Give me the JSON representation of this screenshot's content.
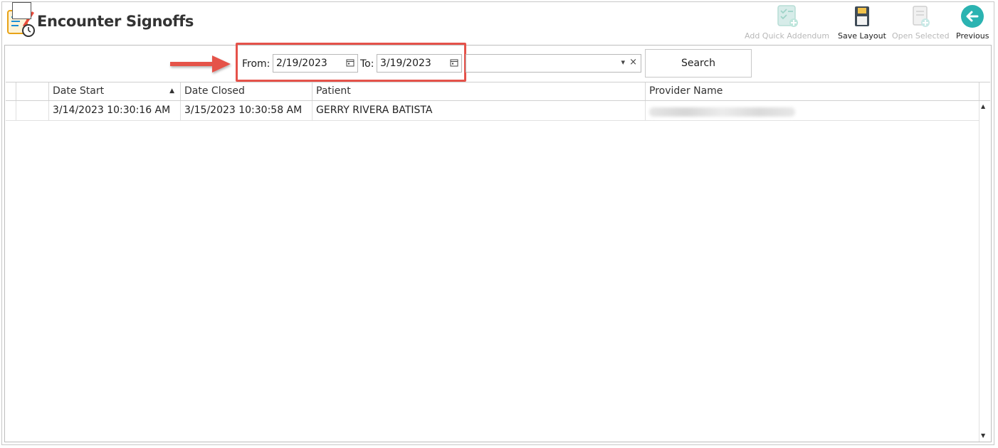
{
  "header": {
    "title": "Encounter Signoffs",
    "icons": {
      "logo": "clipboard-pencil-clock-icon"
    }
  },
  "toolbar": {
    "add_quick_addendum": "Add Quick Addendum",
    "save_layout": "Save Layout",
    "open_selected": "Open Selected",
    "previous": "Previous"
  },
  "filters": {
    "from_label": "From:",
    "from_value": "2/19/2023",
    "to_label": "To:",
    "to_value": "3/19/2023",
    "search_label": "Search",
    "clear_symbol": "×",
    "dropdown_symbol": "▾"
  },
  "grid": {
    "columns": [
      "Date Start",
      "Date Closed",
      "Patient",
      "Provider Name"
    ],
    "sort_symbol": "▲",
    "rows": [
      {
        "date_start": "3/14/2023 10:30:16 AM",
        "date_closed": "3/15/2023 10:30:58 AM",
        "patient": "GERRY RIVERA BATISTA",
        "provider": ""
      }
    ]
  },
  "colors": {
    "highlight": "#e5524a",
    "arrow": "#e5524a",
    "previous_icon": "#2bb3b1",
    "disabled_text": "#b8b8b8"
  },
  "scroll": {
    "up": "▲",
    "down": "▼"
  }
}
